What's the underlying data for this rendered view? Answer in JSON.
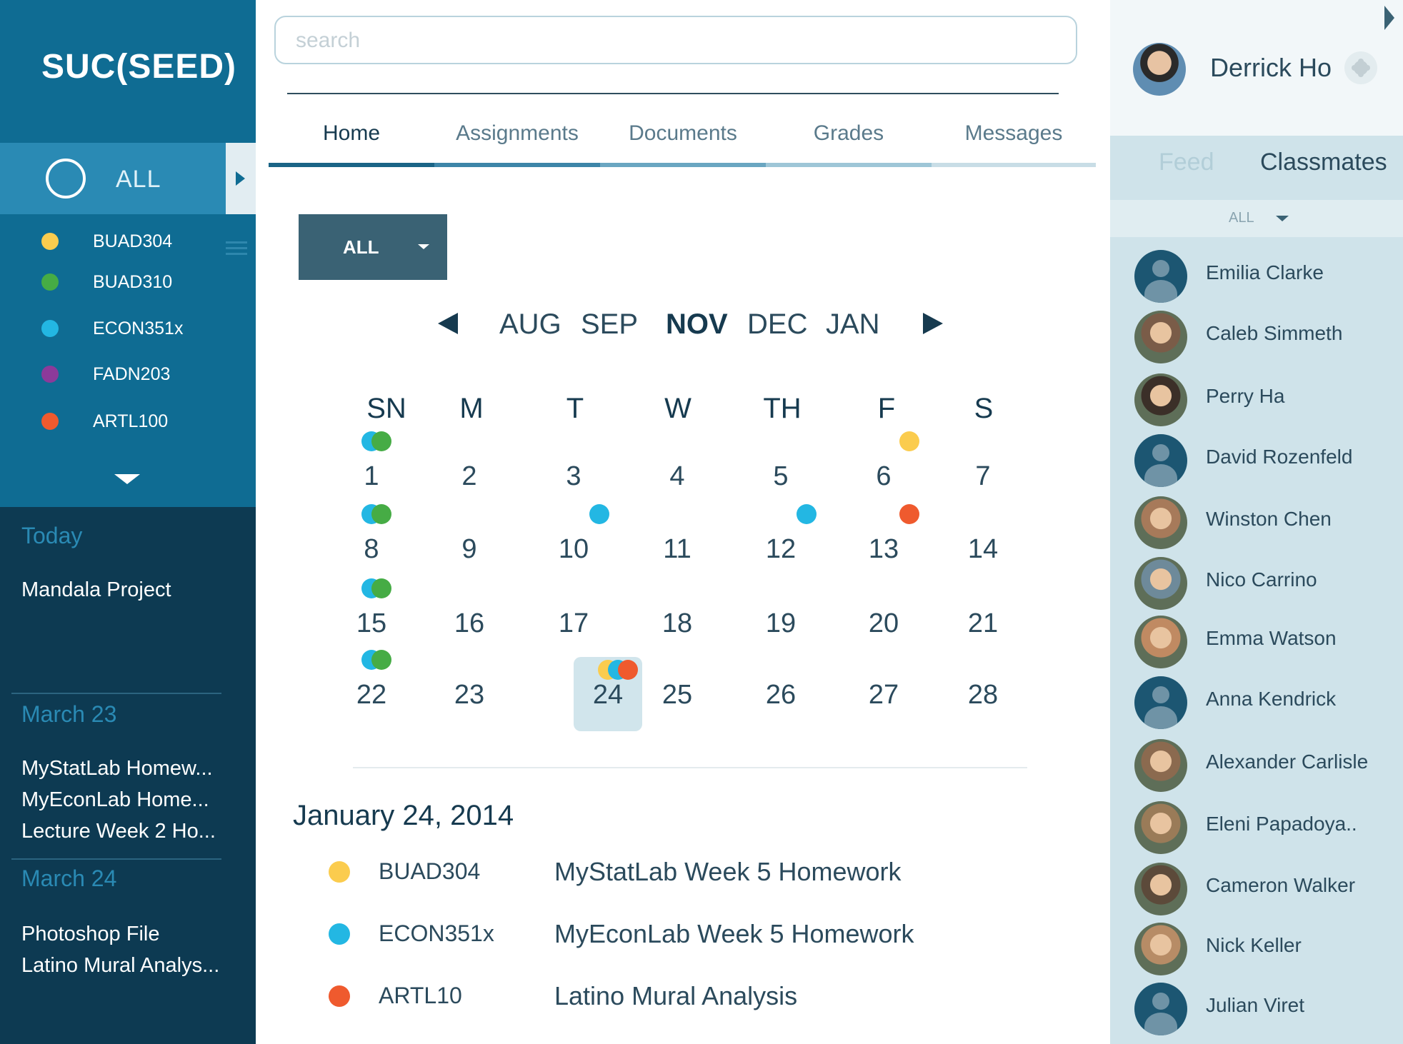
{
  "app": {
    "logo": "SUC(SEED)"
  },
  "sidebar": {
    "all_label": "ALL",
    "courses": [
      {
        "code": "BUAD304",
        "color": "#fbcc4e"
      },
      {
        "code": "BUAD310",
        "color": "#46ac45"
      },
      {
        "code": "ECON351x",
        "color": "#23b7e3"
      },
      {
        "code": "FADN203",
        "color": "#8c3a9a"
      },
      {
        "code": "ARTL100",
        "color": "#ef5a2e"
      }
    ],
    "agenda": [
      {
        "heading": "Today",
        "items": [
          "Mandala Project"
        ]
      },
      {
        "heading": "March 23",
        "items": [
          "MyStatLab Homew...",
          "MyEconLab Home...",
          "Lecture Week 2 Ho..."
        ]
      },
      {
        "heading": "March 24",
        "items": [
          "Photoshop File",
          "Latino Mural Analys..."
        ]
      }
    ]
  },
  "main": {
    "search": {
      "placeholder": "search",
      "value": ""
    },
    "tabs": [
      {
        "label": "Home",
        "active": true
      },
      {
        "label": "Assignments",
        "active": false
      },
      {
        "label": "Documents",
        "active": false
      },
      {
        "label": "Grades",
        "active": false
      },
      {
        "label": "Messages",
        "active": false
      }
    ],
    "filter": {
      "value": "ALL"
    },
    "months": [
      {
        "label": "AUG",
        "active": false
      },
      {
        "label": "SEP",
        "active": false
      },
      {
        "label": "NOV",
        "active": true
      },
      {
        "label": "DEC",
        "active": false
      },
      {
        "label": "JAN",
        "active": false
      }
    ],
    "calendar": {
      "weekdays": [
        "SN",
        "M",
        "T",
        "W",
        "TH",
        "F",
        "S"
      ],
      "weeks": [
        [
          1,
          2,
          3,
          4,
          5,
          6,
          7
        ],
        [
          8,
          9,
          10,
          11,
          12,
          13,
          14
        ],
        [
          15,
          16,
          17,
          18,
          19,
          20,
          21
        ],
        [
          22,
          23,
          24,
          25,
          26,
          27,
          28
        ]
      ],
      "selected_day": 24,
      "events": {
        "1": [
          "ECON351x",
          "BUAD310"
        ],
        "6": [
          "BUAD304"
        ],
        "8": [
          "ECON351x",
          "BUAD310"
        ],
        "10": [
          "ECON351x"
        ],
        "12": [
          "ECON351x"
        ],
        "13": [
          "ARTL100"
        ],
        "15": [
          "ECON351x",
          "BUAD310"
        ],
        "22": [
          "ECON351x",
          "BUAD310"
        ],
        "24": [
          "BUAD304",
          "ECON351x",
          "ARTL100"
        ]
      }
    },
    "selected_date": "January 24, 2014",
    "events": [
      {
        "course": "BUAD304",
        "title": "MyStatLab Week 5 Homework",
        "color": "#fbcc4e"
      },
      {
        "course": "ECON351x",
        "title": "MyEconLab Week 5 Homework",
        "color": "#23b7e3"
      },
      {
        "course": "ARTL10",
        "title": "Latino Mural Analysis",
        "color": "#ef5a2e"
      }
    ]
  },
  "right": {
    "user": {
      "name": "Derrick Ho"
    },
    "tabs": {
      "feed": "Feed",
      "classmates": "Classmates"
    },
    "filter": "ALL",
    "classmates": [
      {
        "name": "Emilia Clarke",
        "photo": false
      },
      {
        "name": "Caleb Simmeth",
        "photo": true
      },
      {
        "name": "Perry Ha",
        "photo": true
      },
      {
        "name": "David Rozenfeld",
        "photo": false
      },
      {
        "name": "Winston Chen",
        "photo": true
      },
      {
        "name": "Nico Carrino",
        "photo": true
      },
      {
        "name": "Emma Watson",
        "photo": true
      },
      {
        "name": "Anna Kendrick",
        "photo": false
      },
      {
        "name": "Alexander Carlisle",
        "photo": true
      },
      {
        "name": "Eleni Papadoya..",
        "photo": true
      },
      {
        "name": "Cameron Walker",
        "photo": true
      },
      {
        "name": "Nick Keller",
        "photo": true
      },
      {
        "name": "Julian Viret",
        "photo": false
      }
    ]
  },
  "colors": {
    "sidebar": "#0f6c93",
    "sidebar_dark": "#0d3a52",
    "accent": "#2a8ab4",
    "text": "#2b4a5c",
    "selected_day": "#d1e5ec"
  }
}
